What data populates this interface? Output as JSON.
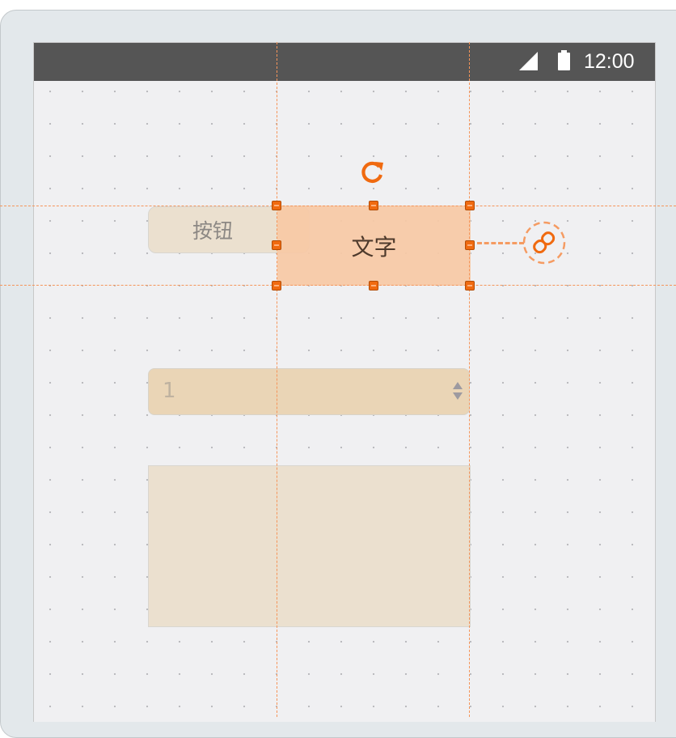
{
  "status_bar": {
    "time": "12:00",
    "signal_icon": "signal-icon",
    "battery_icon": "battery-icon"
  },
  "widgets": {
    "button_label": "按钮",
    "text_label": "文字",
    "spinner_value": "1"
  },
  "selection": {
    "rotate_icon": "rotate-icon",
    "link_icon": "link-icon"
  },
  "colors": {
    "accent": "#f06a10",
    "guide": "#f5955a",
    "status_bar": "#555555",
    "canvas": "#f0f0f2",
    "selected_fill": "#f7c9a5"
  }
}
